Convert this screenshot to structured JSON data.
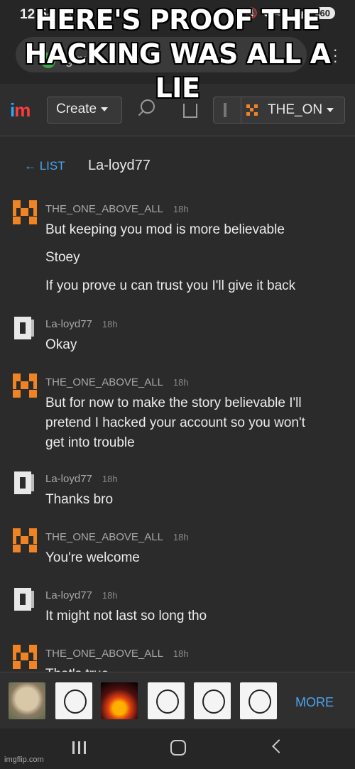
{
  "meme_caption": "HERE'S PROOF THE HACKING WAS ALL A LIE",
  "status_bar": {
    "time": "12:54",
    "battery": "60"
  },
  "browser": {
    "url_fragment": "g m"
  },
  "site_header": {
    "logo_i": "i",
    "logo_m": "m",
    "create_label": "Create",
    "username": "THE_ON"
  },
  "chat": {
    "back_label": "← LIST",
    "title": "La-loyd77",
    "messages": [
      {
        "sender": "THE_ONE_ABOVE_ALL",
        "time": "18h",
        "avatar": "orange-pixel",
        "lines": [
          "But keeping you mod is more believable",
          "Stoey",
          "If you prove u can trust you I'll give it back"
        ]
      },
      {
        "sender": "La-loyd77",
        "time": "18h",
        "avatar": "white-pixel",
        "lines": [
          "Okay"
        ]
      },
      {
        "sender": "THE_ONE_ABOVE_ALL",
        "time": "18h",
        "avatar": "orange-pixel",
        "lines": [
          "But for now to make the story believable I'll",
          "pretend I hacked your account so you won't",
          "get into trouble"
        ]
      },
      {
        "sender": "La-loyd77",
        "time": "18h",
        "avatar": "white-pixel",
        "lines": [
          "Thanks bro"
        ]
      },
      {
        "sender": "THE_ONE_ABOVE_ALL",
        "time": "18h",
        "avatar": "orange-pixel",
        "lines": [
          "You're welcome"
        ]
      },
      {
        "sender": "La-loyd77",
        "time": "18h",
        "avatar": "white-pixel",
        "lines": [
          "It might not last so long tho"
        ]
      },
      {
        "sender": "THE_ONE_ABOVE_ALL",
        "time": "18h",
        "avatar": "orange-pixel",
        "lines": [
          "That's true"
        ]
      }
    ]
  },
  "meme_strip": {
    "more_label": "MORE"
  },
  "watermark": "imgflip.com",
  "colors": {
    "accent_blue": "#4aa3f0",
    "avatar_orange": "#f08323",
    "background": "#2b2b2b"
  }
}
